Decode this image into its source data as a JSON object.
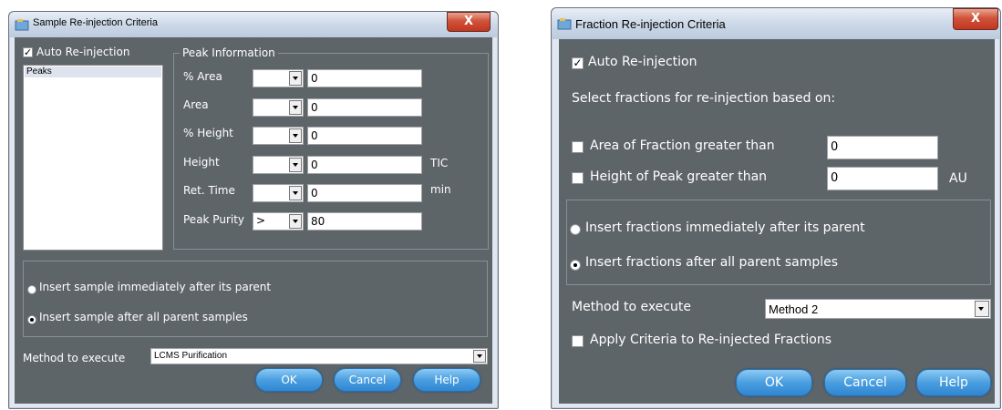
{
  "sample": {
    "title": "Sample Re-injection Criteria",
    "close_label": "X",
    "auto_reinjection_label": "Auto Re-injection",
    "auto_reinjection_checked": true,
    "list_items": [
      "Peaks"
    ],
    "peak_info_legend": "Peak Information",
    "rows": [
      {
        "label": "% Area",
        "operator": "",
        "value": "0",
        "unit": ""
      },
      {
        "label": "Area",
        "operator": "",
        "value": "0",
        "unit": ""
      },
      {
        "label": "% Height",
        "operator": "",
        "value": "0",
        "unit": ""
      },
      {
        "label": "Height",
        "operator": "",
        "value": "0",
        "unit": "TIC"
      },
      {
        "label": "Ret. Time",
        "operator": "",
        "value": "0",
        "unit": "min"
      },
      {
        "label": "Peak Purity",
        "operator": ">",
        "value": "80",
        "unit": ""
      }
    ],
    "radio_immediately": "Insert sample immediately after its parent",
    "radio_after_all": "Insert sample after all parent samples",
    "selected_radio": "after_all",
    "method_label": "Method to execute",
    "method_value": "LCMS Purification",
    "ok_label": "OK",
    "cancel_label": "Cancel",
    "help_label": "Help"
  },
  "fraction": {
    "title": "Fraction Re-injection Criteria",
    "close_label": "X",
    "auto_reinjection_label": "Auto Re-injection",
    "auto_reinjection_checked": true,
    "select_label": "Select fractions for re-injection based on:",
    "area_label": "Area of Fraction greater than",
    "area_value": "0",
    "height_label": "Height of Peak greater than",
    "height_value": "0",
    "height_unit": "AU",
    "radio_immediately": "Insert fractions immediately after its parent",
    "radio_after_all": "Insert fractions after all parent samples",
    "selected_radio": "after_all",
    "method_label": "Method to execute",
    "method_value": "Method 2",
    "apply_label": "Apply Criteria to Re-injected Fractions",
    "ok_label": "OK",
    "cancel_label": "Cancel",
    "help_label": "Help"
  },
  "colors": {
    "panel_bg": "#5e6569",
    "accent_button": "#4a9ee0",
    "close_button": "#c9452e"
  }
}
